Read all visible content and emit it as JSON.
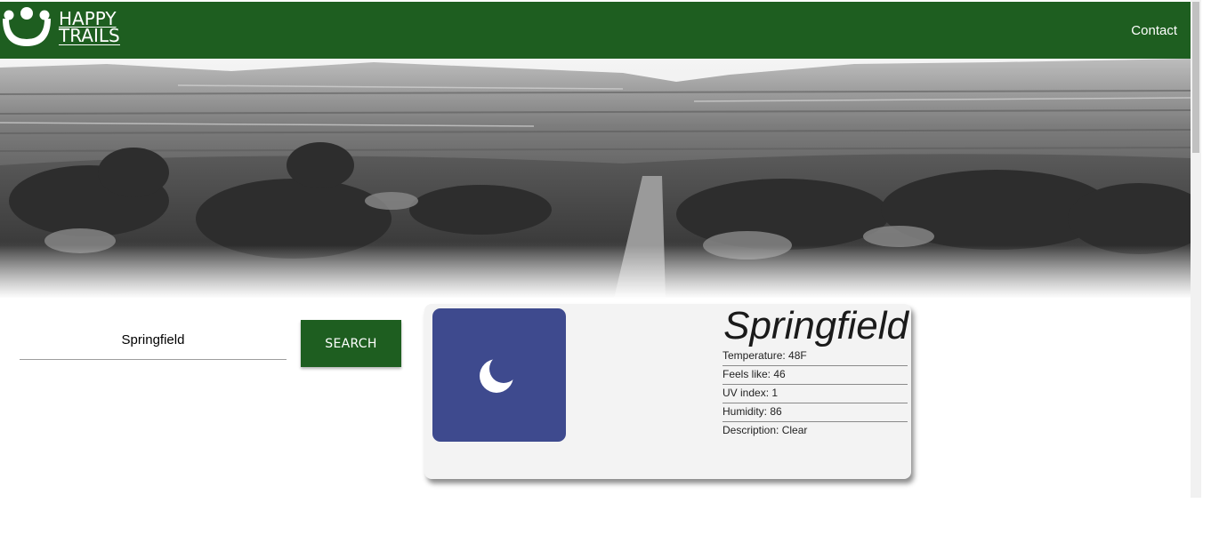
{
  "brand": {
    "line1": "HAPPY",
    "line2": "TRAILS"
  },
  "nav": {
    "contact": "Contact"
  },
  "search": {
    "value": "Springfield",
    "button_label": "SEARCH"
  },
  "weather": {
    "city": "Springfield",
    "icon": "crescent-moon-icon",
    "details": [
      {
        "label": "Temperature:",
        "value": "48F"
      },
      {
        "label": "Feels like:",
        "value": "46"
      },
      {
        "label": "UV index:",
        "value": "1"
      },
      {
        "label": "Humidity:",
        "value": "86"
      },
      {
        "label": "Description:",
        "value": "Clear"
      }
    ]
  },
  "colors": {
    "brand_green": "#1e5e20",
    "icon_tile": "#3e4a8e",
    "card_bg": "#f3f3f3"
  }
}
